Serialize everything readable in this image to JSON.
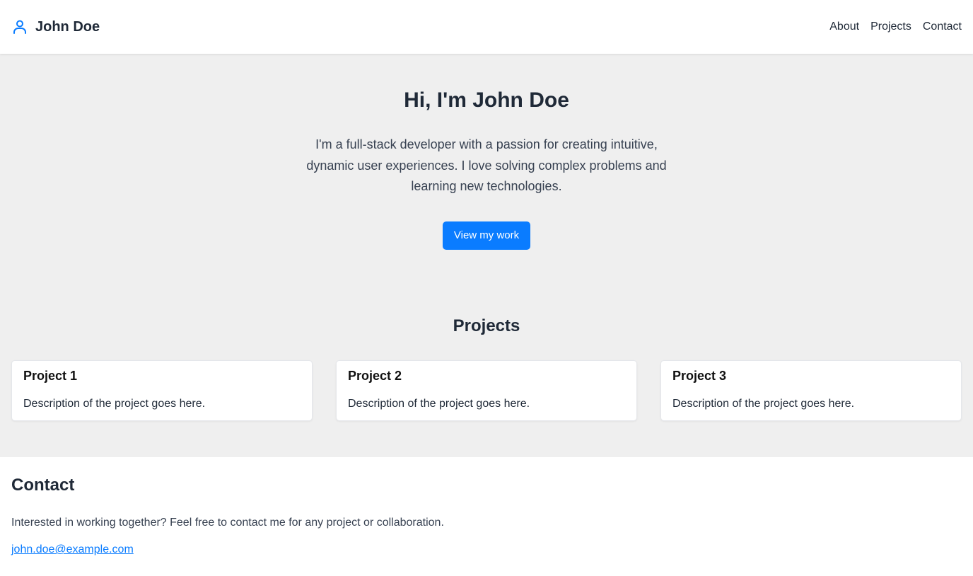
{
  "header": {
    "brand_name": "John Doe",
    "brand_icon": "user-icon",
    "nav": [
      {
        "label": "About"
      },
      {
        "label": "Projects"
      },
      {
        "label": "Contact"
      }
    ]
  },
  "hero": {
    "title": "Hi, I'm John Doe",
    "description": "I'm a full-stack developer with a passion for creating intuitive, dynamic user experiences. I love solving complex problems and learning new technologies.",
    "cta_label": "View my work"
  },
  "projects": {
    "heading": "Projects",
    "items": [
      {
        "title": "Project 1",
        "description": "Description of the project goes here."
      },
      {
        "title": "Project 2",
        "description": "Description of the project goes here."
      },
      {
        "title": "Project 3",
        "description": "Description of the project goes here."
      }
    ]
  },
  "contact": {
    "heading": "Contact",
    "text": "Interested in working together? Feel free to contact me for any project or collaboration.",
    "email": "john.doe@example.com"
  },
  "colors": {
    "accent": "#0a7cff",
    "band_background": "#efefef",
    "text": "#1f2937"
  }
}
